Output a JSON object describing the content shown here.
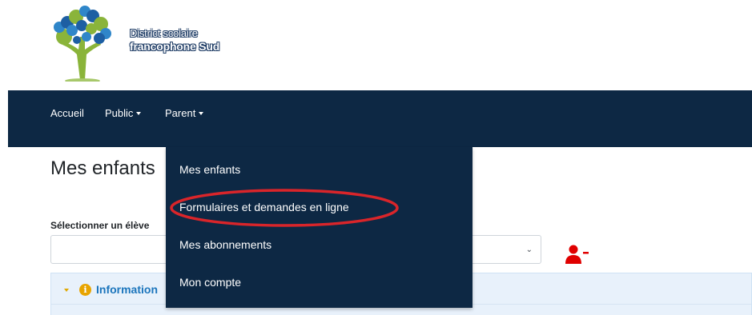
{
  "header": {
    "logo": {
      "icon": "tree-logo-icon"
    },
    "brand_line1": "District scolaire",
    "brand_line2": "francophone Sud"
  },
  "nav": {
    "items": [
      {
        "label": "Accueil",
        "has_caret": false
      },
      {
        "label": "Public",
        "has_caret": true
      },
      {
        "label": "Parent",
        "has_caret": true
      }
    ],
    "background": "#0d2844"
  },
  "main": {
    "title": "Mes enfants",
    "select_label": "Sélectionner un élève",
    "select_value": "",
    "remove_icon": "user-minus-icon",
    "remove_icon_color": "#e00000",
    "info_panel_title": "Information"
  },
  "dropdown": {
    "items": [
      {
        "label": "Mes enfants",
        "highlighted": false
      },
      {
        "label": "Formulaires et demandes en ligne",
        "highlighted": true
      },
      {
        "label": "Mes abonnements",
        "highlighted": false
      },
      {
        "label": "Mon compte",
        "highlighted": false
      }
    ],
    "highlight_color": "#d9252a"
  }
}
